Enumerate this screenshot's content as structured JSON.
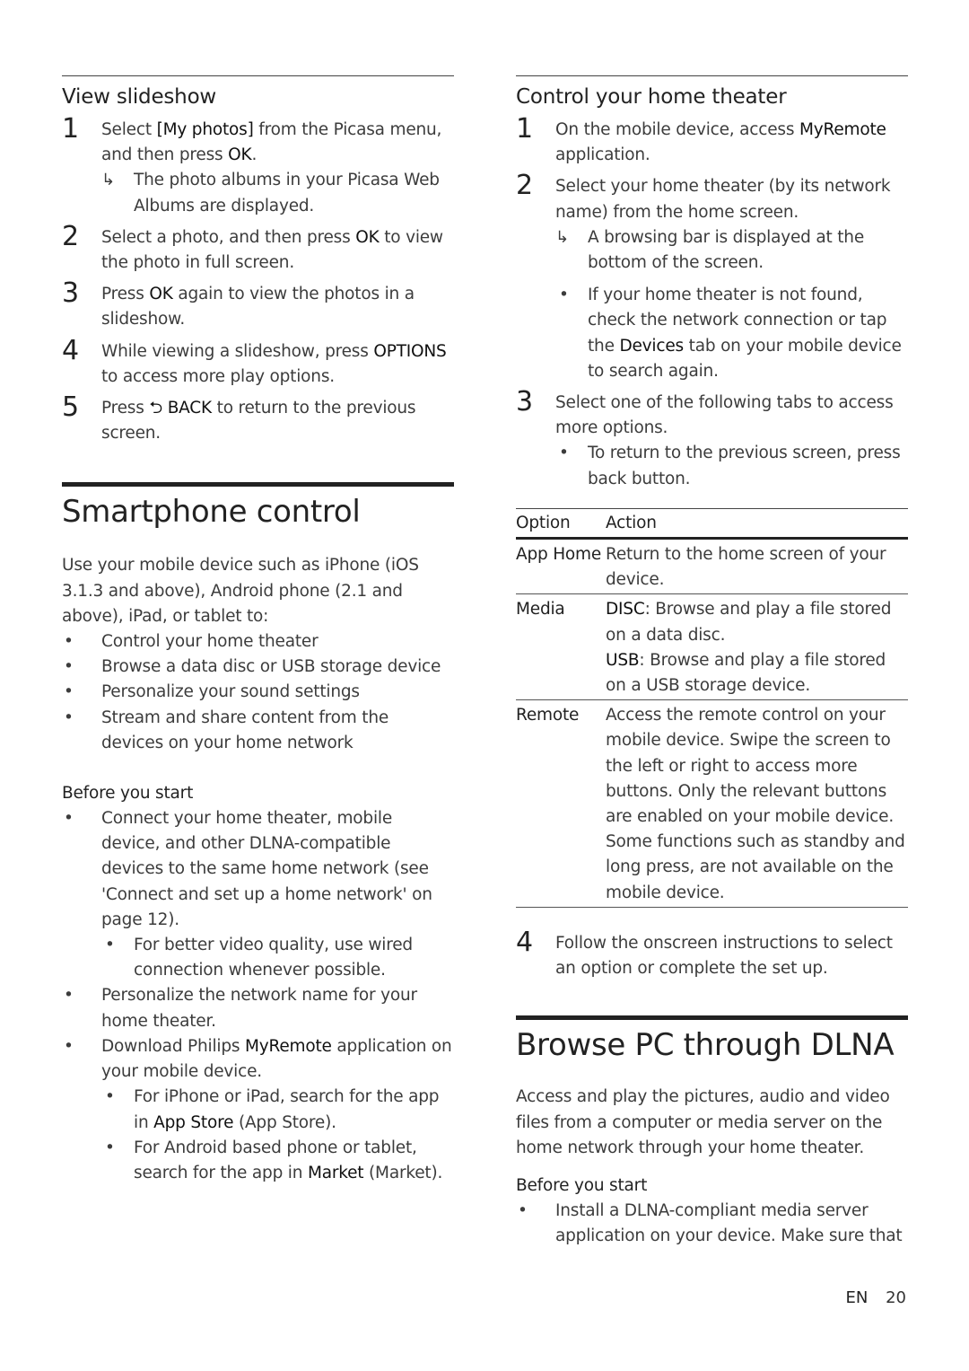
{
  "left": {
    "view_slideshow": {
      "title": "View slideshow",
      "steps": [
        {
          "num": "1",
          "pre": "Select ",
          "bold": "[My photos]",
          "post": " from the Picasa menu, and then press ",
          "bold2": "OK",
          "post2": ".",
          "result": "The photo albums in your Picasa Web Albums are displayed."
        },
        {
          "num": "2",
          "pre": "Select a photo, and then press ",
          "bold": "OK",
          "post": " to view the photo in full screen."
        },
        {
          "num": "3",
          "pre": "Press ",
          "bold": "OK",
          "post": " again to view the photos in a slideshow."
        },
        {
          "num": "4",
          "pre": "While viewing a slideshow, press ",
          "bold": "OPTIONS",
          "post": " to access more play options."
        },
        {
          "num": "5",
          "pre": "Press ",
          "icon": "back-icon",
          "bold": "BACK",
          "post": " to return to the previous screen."
        }
      ]
    },
    "smartphone": {
      "title": "Smartphone control",
      "intro": "Use your mobile device such as iPhone (iOS 3.1.3 and above), Android phone (2.1 and above), iPad, or tablet to:",
      "bullets": [
        "Control your home theater",
        "Browse a data disc or USB storage device",
        "Personalize your sound settings",
        "Stream and share content from the devices on your home network"
      ],
      "before_label": "Before you start",
      "before": {
        "b1": "Connect your home theater, mobile device, and other DLNA-compatible devices to the same home network (see 'Connect and set up a home network' on page 12).",
        "b1_sub": "For better video quality, use wired connection whenever possible.",
        "b2": "Personalize the network name for your home theater.",
        "b3_pre": "Download Philips ",
        "b3_bold": "MyRemote",
        "b3_post": " application on your mobile device.",
        "b3_sub1_pre": "For iPhone or iPad, search for the app in ",
        "b3_sub1_bold": "App Store",
        "b3_sub1_post": " (App Store).",
        "b3_sub2_pre": "For Android based phone or tablet, search for the app in ",
        "b3_sub2_bold": "Market",
        "b3_sub2_post": " (Market)."
      }
    }
  },
  "right": {
    "control": {
      "title": "Control your home theater",
      "s1_num": "1",
      "s1_pre": "On the mobile device, access ",
      "s1_bold": "MyRemote",
      "s1_post": " application.",
      "s2_num": "2",
      "s2_text": "Select your home theater (by its network name) from the home screen.",
      "s2_result": "A browsing bar is displayed at the bottom of the screen.",
      "s2_note_pre": "If your home theater is not found, check the network connection or tap the ",
      "s2_note_bold": "Devices",
      "s2_note_post": " tab on your mobile device to search again.",
      "s3_num": "3",
      "s3_text": "Select one of the following tabs to access more options.",
      "s3_note": "To return to the previous screen, press back button.",
      "table": {
        "headers": [
          "Option",
          "Action"
        ],
        "rows": [
          {
            "option": "App Home",
            "action": "Return to the home screen of your device."
          },
          {
            "option": "Media",
            "disc_bold": "DISC",
            "disc_text": ": Browse and play a file stored on a data disc.",
            "usb_bold": "USB",
            "usb_text": ": Browse and play a file stored on a USB storage device."
          },
          {
            "option": "Remote",
            "action": "Access the remote control on your mobile device. Swipe the screen to the left or right to access more buttons. Only the relevant buttons are enabled on your mobile device. Some functions such as standby and long press, are not available on the mobile device."
          }
        ]
      },
      "s4_num": "4",
      "s4_text": "Follow the onscreen instructions to select an option or complete the set up."
    },
    "dlna": {
      "title": "Browse PC through DLNA",
      "intro": "Access and play the pictures, audio and video files from a computer or media server on the home network through your home theater.",
      "before_label": "Before you start",
      "bullet1": "Install a DLNA-compliant media server application on your device. Make sure that"
    }
  },
  "footer": {
    "lang": "EN",
    "page": "20"
  }
}
